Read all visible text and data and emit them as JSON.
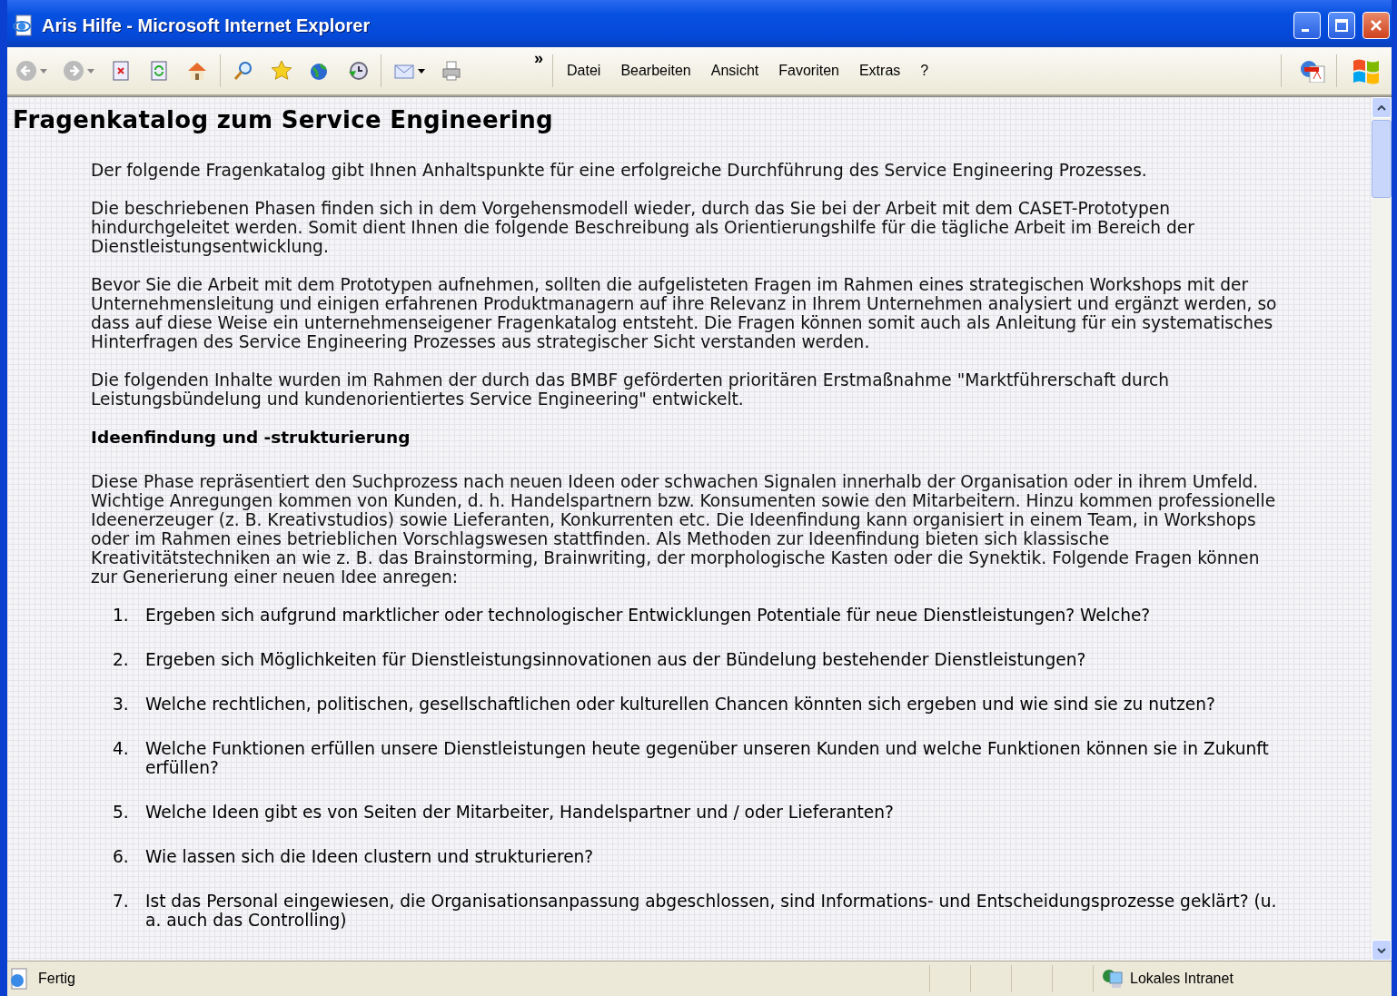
{
  "window": {
    "title": "Aris Hilfe - Microsoft Internet Explorer"
  },
  "toolbar": {
    "overflow": "»"
  },
  "menu": [
    {
      "label": "Datei"
    },
    {
      "label": "Bearbeiten"
    },
    {
      "label": "Ansicht"
    },
    {
      "label": "Favoriten"
    },
    {
      "label": "Extras"
    },
    {
      "label": "?"
    }
  ],
  "page": {
    "heading": "Fragenkatalog zum Service Engineering",
    "intro": [
      "Der folgende Fragenkatalog gibt Ihnen Anhaltspunkte für eine erfolgreiche Durchführung des Service Engineering Prozesses.",
      "Die beschriebenen Phasen finden sich in dem Vorgehensmodell wieder, durch das Sie bei der Arbeit mit dem CASET-Prototypen hindurchgeleitet werden. Somit dient Ihnen die folgende Beschreibung als Orientierungshilfe für die tägliche Arbeit im Bereich der Dienstleistungsentwicklung.",
      "Bevor Sie die Arbeit mit dem Prototypen aufnehmen, sollten die aufgelisteten Fragen im Rahmen eines strategischen Workshops mit der Unternehmensleitung und einigen erfahrenen Produktmanagern auf ihre Relevanz in Ihrem Unternehmen analysiert und ergänzt werden, so dass auf diese Weise ein unternehmenseigener Fragenkatalog entsteht. Die Fragen können somit auch als Anleitung für ein systematisches Hinterfragen des Service Engineering Prozesses aus strategischer Sicht verstanden werden.",
      "Die folgenden Inhalte wurden im Rahmen der durch das BMBF geförderten prioritären Erstmaßnahme \"Marktführerschaft durch Leistungsbündelung und kundenorientiertes Service Engineering\" entwickelt."
    ],
    "section_heading": "Ideenfindung und -strukturierung",
    "section_text": "Diese Phase repräsentiert den Suchprozess nach neuen Ideen oder schwachen Signalen innerhalb der Organisation oder in ihrem Umfeld. Wichtige Anregungen kommen von Kunden, d. h. Handelspartnern bzw. Konsumenten sowie den Mitarbeitern. Hinzu kommen professionelle Ideenerzeuger (z. B. Kreativstudios) sowie Lieferanten, Konkurrenten etc. Die Ideenfindung kann organisiert in einem Team, in Workshops oder im Rahmen eines betrieblichen Vorschlagswesen stattfinden. Als Methoden zur Ideenfindung bieten sich klassische Kreativitätstechniken an wie z. B. das Brainstorming, Brainwriting, der morphologische Kasten oder die Synektik. Folgende Fragen können zur Generierung einer neuen Idee anregen:",
    "questions": [
      {
        "number": "1.",
        "text": "Ergeben sich aufgrund marktlicher oder technologischer Entwicklungen Potentiale für neue Dienstleistungen? Welche?"
      },
      {
        "number": "2.",
        "text": "Ergeben sich Möglichkeiten für Dienstleistungsinnovationen aus der Bündelung bestehender Dienstleistungen?"
      },
      {
        "number": "3.",
        "text": "Welche rechtlichen, politischen, gesellschaftlichen oder kulturellen Chancen könnten sich ergeben und wie sind sie zu nutzen?"
      },
      {
        "number": "4.",
        "text": "Welche Funktionen erfüllen unsere Dienstleistungen heute gegenüber unseren Kunden und welche Funktionen können sie in Zukunft erfüllen?"
      },
      {
        "number": "5.",
        "text": "Welche Ideen gibt es von Seiten der Mitarbeiter, Handelspartner und / oder Lieferanten?"
      },
      {
        "number": "6.",
        "text": "Wie lassen sich die Ideen clustern und strukturieren?"
      },
      {
        "number": "7.",
        "text": "Ist das Personal eingewiesen, die Organisationsanpassung abgeschlossen, sind Informations- und Entscheidungsprozesse geklärt? (u. a. auch das Controlling)"
      }
    ]
  },
  "status_bar": {
    "text": "Fertig",
    "zone": "Lokales Intranet"
  }
}
